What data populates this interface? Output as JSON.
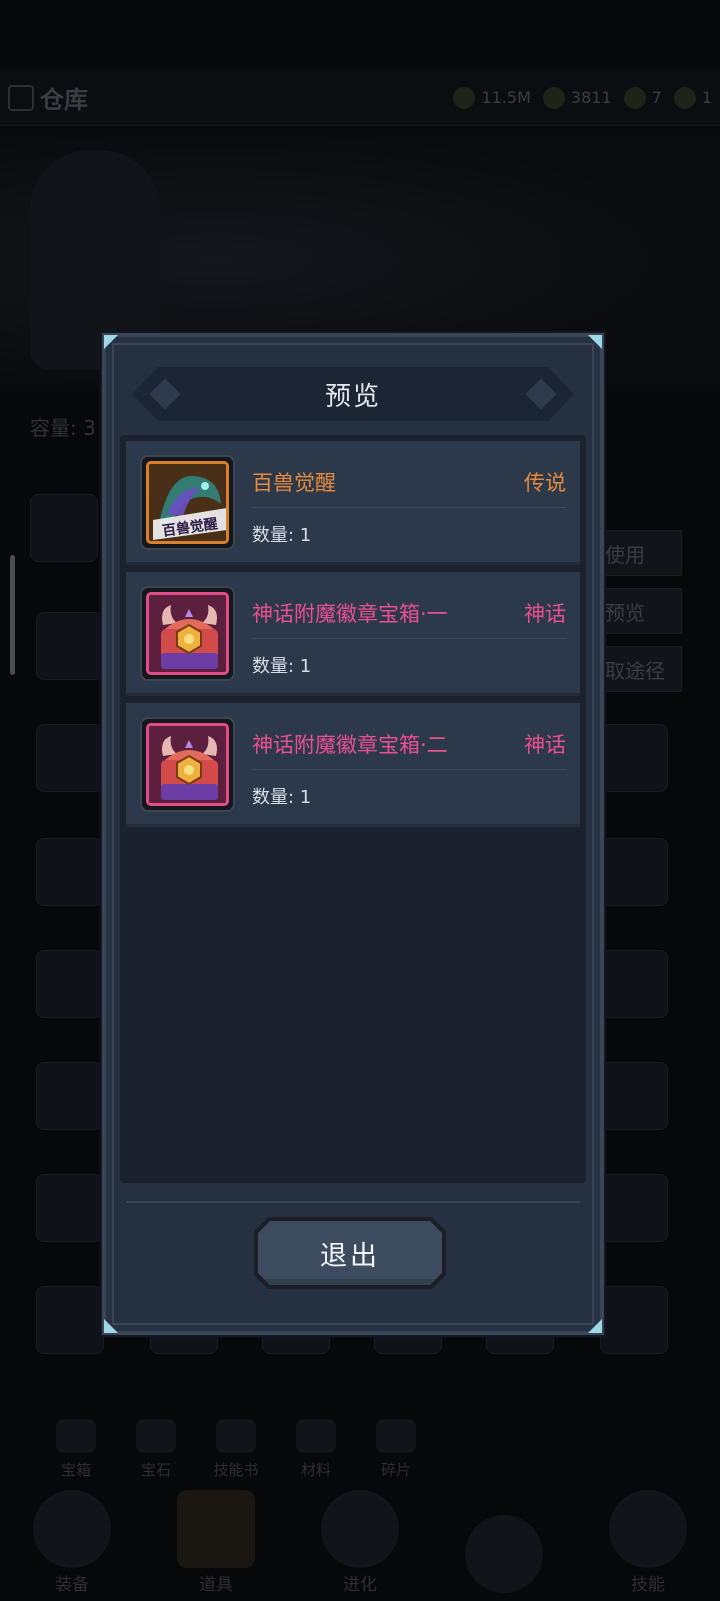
{
  "background": {
    "title": "仓库",
    "resources": [
      "11.5M",
      "3811",
      "7",
      "1"
    ],
    "capacity_label": "容量: 3",
    "side_buttons": [
      "使用",
      "预览",
      "取途径"
    ],
    "categories": [
      "宝箱",
      "宝石",
      "技能书",
      "材料",
      "碎片"
    ],
    "nav": [
      "装备",
      "道具",
      "进化",
      "",
      "技能"
    ]
  },
  "modal": {
    "title": "预览",
    "items": [
      {
        "name": "百兽觉醒",
        "rarity": "传说",
        "quantity": "数量: 1",
        "color": "#e88a3c",
        "icon": "beast-awaken-icon",
        "icon_text": "百兽觉醒"
      },
      {
        "name": "神话附魔徽章宝箱·一",
        "rarity": "神话",
        "quantity": "数量: 1",
        "color": "#ec4f8f",
        "icon": "myth-chest-icon"
      },
      {
        "name": "神话附魔徽章宝箱·二",
        "rarity": "神话",
        "quantity": "数量: 1",
        "color": "#ec4f8f",
        "icon": "myth-chest-icon"
      }
    ],
    "exit_label": "退出"
  }
}
